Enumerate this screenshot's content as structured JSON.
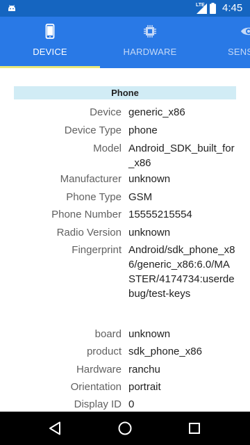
{
  "status_bar": {
    "time": "4:45",
    "network_label": "LTE"
  },
  "tabs": [
    {
      "label": "DEVICE",
      "icon": "phone-icon",
      "active": true
    },
    {
      "label": "HARDWARE",
      "icon": "chip-icon",
      "active": false
    },
    {
      "label": "SENS",
      "icon": "eye-icon",
      "active": false
    }
  ],
  "section": {
    "title": "Phone",
    "rows": [
      {
        "label": "Device",
        "value": "generic_x86"
      },
      {
        "label": "Device Type",
        "value": "phone"
      },
      {
        "label": "Model",
        "value": "Android_SDK_built_for_x86"
      },
      {
        "label": "Manufacturer",
        "value": "unknown"
      },
      {
        "label": "Phone Type",
        "value": "GSM"
      },
      {
        "label": "Phone Number",
        "value": "15555215554"
      },
      {
        "label": "Radio Version",
        "value": "unknown"
      },
      {
        "label": "Fingerprint",
        "value": "Android/sdk_phone_x86/generic_x86:6.0/MASTER/4174734:userdebug/test-keys"
      },
      {
        "label": "board",
        "value": "unknown"
      },
      {
        "label": "product",
        "value": "sdk_phone_x86"
      },
      {
        "label": "Hardware",
        "value": "ranchu"
      },
      {
        "label": "Orientation",
        "value": "portrait"
      },
      {
        "label": "Display ID",
        "value": "0"
      }
    ]
  },
  "nav_bar": {
    "back": "back-icon",
    "home": "home-icon",
    "recents": "recents-icon"
  },
  "colors": {
    "status_bar": "#1565c0",
    "tab_bar": "#2979e6",
    "tab_indicator": "#e8e87a",
    "section_header_bg": "#d1ecf5",
    "nav_bar": "#000000"
  }
}
